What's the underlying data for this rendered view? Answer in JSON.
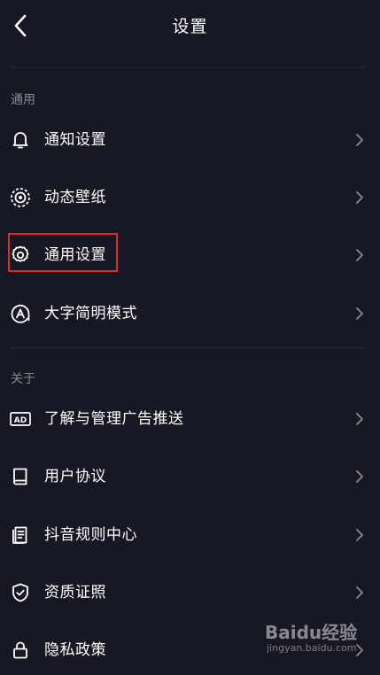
{
  "header": {
    "title": "设置"
  },
  "sections": [
    {
      "label": "通用",
      "items": [
        {
          "label": "通知设置",
          "icon": "bell-icon"
        },
        {
          "label": "动态壁纸",
          "icon": "live-wallpaper-icon"
        },
        {
          "label": "通用设置",
          "icon": "gear-icon",
          "highlighted": true
        },
        {
          "label": "大字简明模式",
          "icon": "font-size-icon"
        }
      ]
    },
    {
      "label": "关于",
      "items": [
        {
          "label": "了解与管理广告推送",
          "icon": "ad-icon"
        },
        {
          "label": "用户协议",
          "icon": "book-icon"
        },
        {
          "label": "抖音规则中心",
          "icon": "document-icon"
        },
        {
          "label": "资质证照",
          "icon": "shield-check-icon"
        },
        {
          "label": "隐私政策",
          "icon": "lock-icon"
        }
      ]
    }
  ],
  "watermark": {
    "brand": "Baidu经验",
    "url": "jingyan.baidu.com"
  },
  "colors": {
    "background": "#161823",
    "text": "#ffffff",
    "section_label": "#8a8b91",
    "divider": "#262834",
    "highlight": "#e02a2a"
  }
}
